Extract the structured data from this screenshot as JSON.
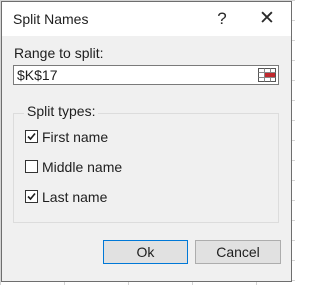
{
  "dialog": {
    "title": "Split Names",
    "help_glyph": "?",
    "close_glyph": "✕"
  },
  "range": {
    "label": "Range to split:",
    "value": "$K$17",
    "picker_icon": "range-select-icon"
  },
  "split_types": {
    "label": "Split types:",
    "options": [
      {
        "label": "First name",
        "checked": true
      },
      {
        "label": "Middle name",
        "checked": false
      },
      {
        "label": "Last name",
        "checked": true
      }
    ]
  },
  "buttons": {
    "ok": "Ok",
    "cancel": "Cancel"
  },
  "colors": {
    "dialog_bg": "#f0f0f0",
    "focus_border": "#0078d7",
    "picker_red": "#c0282d"
  }
}
